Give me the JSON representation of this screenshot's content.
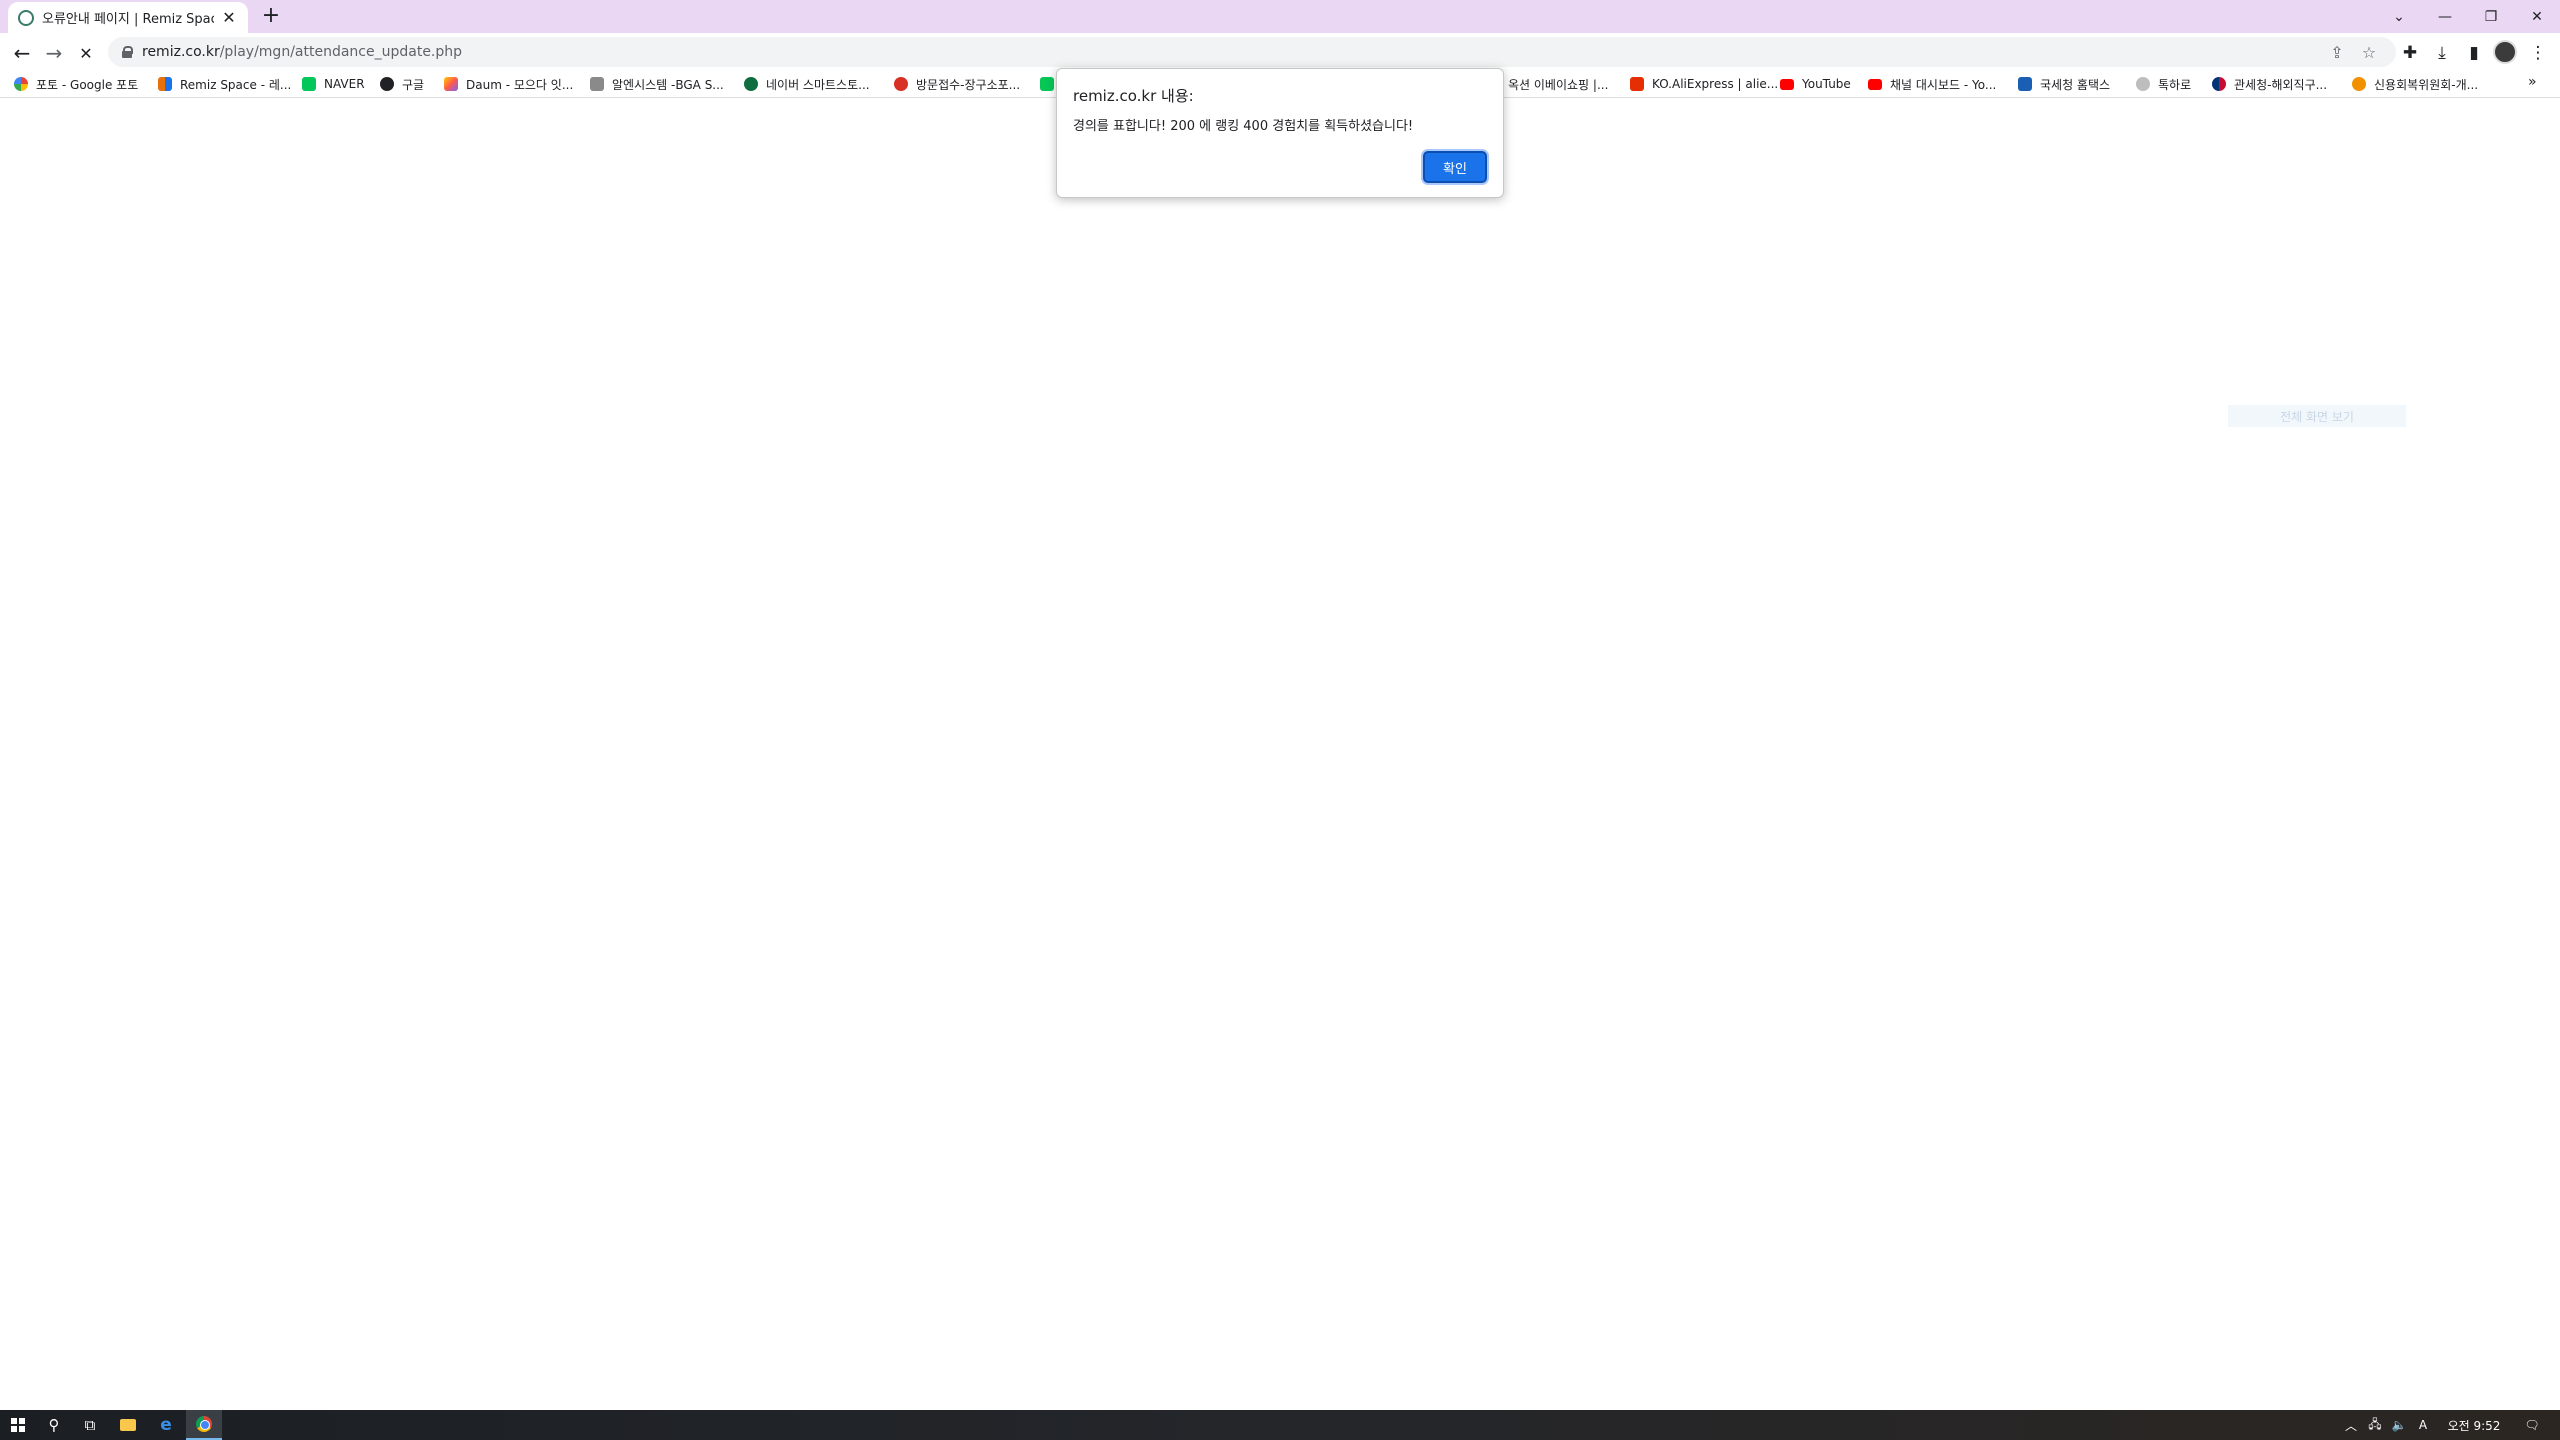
{
  "browser": {
    "tab": {
      "title": "오류안내 페이지 | Remiz Space",
      "close": "✕"
    },
    "new_tab": "+",
    "window_controls": {
      "tab_search": "⌄",
      "minimize": "—",
      "restore": "❐",
      "close": "✕"
    },
    "toolbar": {
      "back": "←",
      "forward": "→",
      "stop": "✕",
      "url_host": "remiz.co.kr",
      "url_path": "/play/mgn/attendance_update.php",
      "share": "⇪",
      "star": "☆",
      "extensions": "✚",
      "download": "⤓",
      "sidepanel": "▮",
      "menu": "⋮"
    },
    "bookmarks": [
      {
        "label": "포토 - Google 포토",
        "icon": "photos-icon",
        "color": "#f4b400"
      },
      {
        "label": "Remiz Space - 레...",
        "icon": "remiz-icon",
        "color": "#e8710a"
      },
      {
        "label": "NAVER",
        "icon": "naver-icon",
        "color": "#03c75a"
      },
      {
        "label": "구글",
        "icon": "globe-icon",
        "color": "#202124"
      },
      {
        "label": "Daum - 모으다 잇...",
        "icon": "daum-icon",
        "color": "#7b61ff"
      },
      {
        "label": "알엔시스템 -BGA S...",
        "icon": "rnsystem-icon",
        "color": "#6d6d6d"
      },
      {
        "label": "네이버 스마트스토...",
        "icon": "smartstore-icon",
        "color": "#0f6e3f"
      },
      {
        "label": "방문접수-장구소포...",
        "icon": "post-icon",
        "color": "#d93025"
      },
      {
        "label": "",
        "icon": "line-icon",
        "color": "#06c755"
      },
      {
        "label": "옥션 이베이쇼핑 |...",
        "icon": "auction-icon",
        "color": "#ffffff"
      },
      {
        "label": "KO.AliExpress | alie...",
        "icon": "aliexpress-icon",
        "color": "#e62e04"
      },
      {
        "label": "YouTube",
        "icon": "youtube-icon",
        "color": "#ff0000"
      },
      {
        "label": "채널 대시보드 - Yo...",
        "icon": "youtube-studio-icon",
        "color": "#ff0000"
      },
      {
        "label": "국세청 홈택스",
        "icon": "hometax-icon",
        "color": "#1a5fb4"
      },
      {
        "label": "톡하로",
        "icon": "tokharo-icon",
        "color": "#666666"
      },
      {
        "label": "관세청-해외직구...",
        "icon": "customs-icon",
        "color": "#1a3f8f"
      },
      {
        "label": "신용회복위원회-개...",
        "icon": "ccrs-icon",
        "color": "#f29100"
      }
    ],
    "bookmarks_more": "»"
  },
  "page": {
    "faint_text": "전체 화면 보기"
  },
  "dialog": {
    "title": "remiz.co.kr 내용:",
    "message": "경의를 표합니다! 200 에 랭킹 400 경험치를 획득하셨습니다!",
    "ok_label": "확인"
  },
  "taskbar": {
    "tray_up": "︿",
    "network": "🖧",
    "volume": "🔈",
    "ime": "A",
    "time": "오전 9:52",
    "notification": "🗨"
  }
}
